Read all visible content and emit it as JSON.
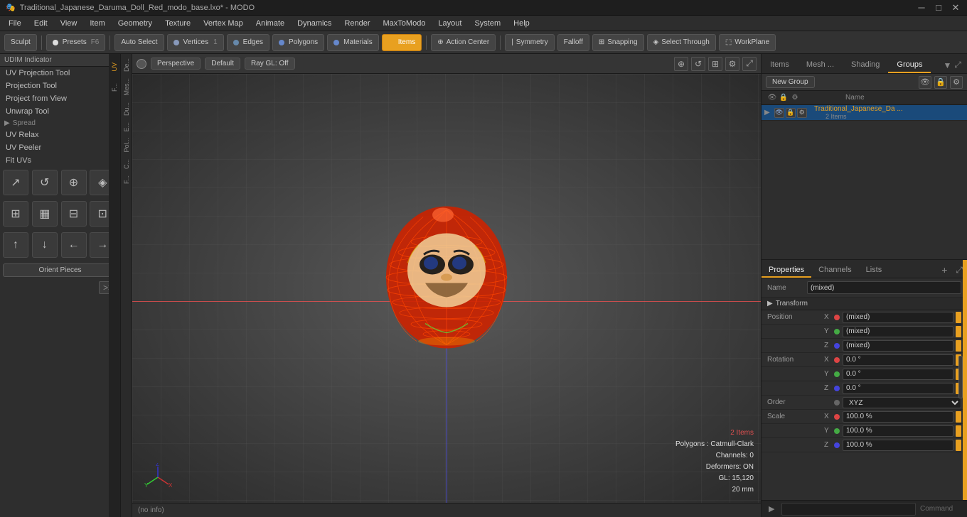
{
  "titlebar": {
    "title": "Traditional_Japanese_Daruma_Doll_Red_modo_base.lxo* - MODO",
    "icon": "🎭"
  },
  "menubar": {
    "items": [
      "File",
      "Edit",
      "View",
      "Item",
      "Geometry",
      "Texture",
      "Vertex Map",
      "Animate",
      "Dynamics",
      "Render",
      "MaxToModo",
      "Layout",
      "System",
      "Help"
    ]
  },
  "toolbar": {
    "sculpt_label": "Sculpt",
    "presets_label": "Presets",
    "presets_key": "F6",
    "auto_select_label": "Auto Select",
    "vertices_label": "Vertices",
    "vertices_num": "1",
    "edges_label": "Edges",
    "polygons_label": "Polygons",
    "materials_label": "Materials",
    "items_label": "Items",
    "action_center_label": "Action Center",
    "symmetry_label": "Symmetry",
    "falloff_label": "Falloff",
    "snapping_label": "Snapping",
    "select_through_label": "Select Through",
    "work_plane_label": "WorkPlane"
  },
  "left_panel": {
    "header": "UDIM Indicator",
    "items": [
      "UV Projection Tool",
      "Project from View",
      "Unwrap Tool"
    ],
    "group_spread": "Spread",
    "item_uv_relax": "UV Relax",
    "item_uv_peeler": "UV Peeler",
    "item_fit_uvs": "Fit UVs",
    "orient_pieces": "Orient Pieces"
  },
  "viewport": {
    "mode_label": "Perspective",
    "shading_label": "Default",
    "raygl_label": "Ray GL: Off",
    "stats_items": "2 Items",
    "stats_polygons": "Polygons : Catmull-Clark",
    "stats_channels": "Channels: 0",
    "stats_deformers": "Deformers: ON",
    "stats_gl": "GL: 15,120",
    "stats_size": "20 mm",
    "info_bar": "(no info)"
  },
  "right_panel": {
    "tabs": [
      "Items",
      "Mesh ...",
      "Shading",
      "Groups"
    ],
    "active_tab": "Groups",
    "new_group_label": "New Group",
    "column_header": "Name",
    "group_item": {
      "name": "Traditional_Japanese_Da ...",
      "count": "2 Items"
    }
  },
  "properties": {
    "tabs": [
      "Properties",
      "Channels",
      "Lists"
    ],
    "add_label": "+",
    "name_label": "Name",
    "name_value": "(mixed)",
    "transform_label": "Transform",
    "fields": {
      "position_label": "Position",
      "pos_x_label": "X",
      "pos_x_value": "(mixed)",
      "pos_y_label": "Y",
      "pos_y_value": "(mixed)",
      "pos_z_label": "Z",
      "pos_z_value": "(mixed)",
      "rotation_label": "Rotation",
      "rot_x_label": "X",
      "rot_x_value": "0.0 °",
      "rot_y_label": "Y",
      "rot_y_value": "0.0 °",
      "rot_z_label": "Z",
      "rot_z_value": "0.0 °",
      "order_label": "Order",
      "order_value": "XYZ",
      "scale_label": "Scale",
      "scale_x_label": "X",
      "scale_x_value": "100.0 %",
      "scale_y_label": "Y",
      "scale_y_value": "100.0 %",
      "scale_z_label": "Z",
      "scale_z_value": "100.0 %"
    }
  },
  "command_bar": {
    "label": "Command",
    "placeholder": ""
  },
  "side_tabs": {
    "labels": [
      "De...",
      "Mes...",
      "Du...",
      "E...",
      "Pol...",
      "C...",
      "F..."
    ]
  }
}
